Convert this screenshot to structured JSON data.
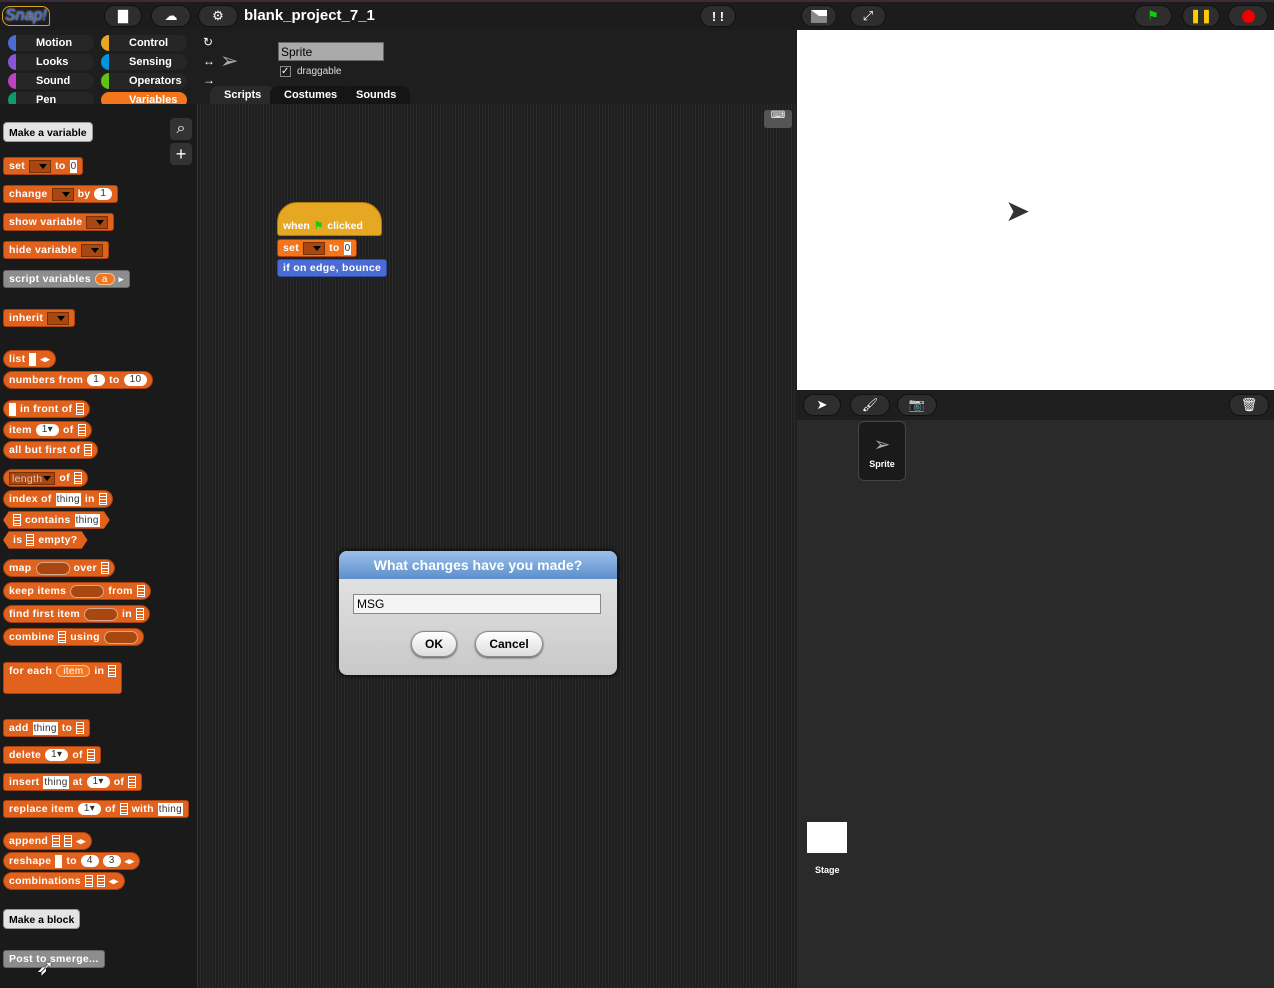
{
  "topbar": {
    "logo": "Snap!",
    "project_title": "blank_project_7_1",
    "icons": [
      "file-icon",
      "cloud-icon",
      "gear-icon",
      "footprints-icon",
      "stage-size-icon",
      "fullscreen-icon",
      "green-flag-icon",
      "pause-icon",
      "stop-icon"
    ]
  },
  "categories": [
    {
      "label": "Motion",
      "color": "#4a6cd4"
    },
    {
      "label": "Looks",
      "color": "#8a55d7"
    },
    {
      "label": "Sound",
      "color": "#bb42c3"
    },
    {
      "label": "Pen",
      "color": "#0e9a6c"
    },
    {
      "label": "Control",
      "color": "#e6a822"
    },
    {
      "label": "Sensing",
      "color": "#0494dc"
    },
    {
      "label": "Operators",
      "color": "#62c213"
    },
    {
      "label": "Variables",
      "color": "#f3761d",
      "selected": true
    }
  ],
  "palette": {
    "make_variable": "Make a variable",
    "make_block": "Make a block",
    "post": "Post to smerge...",
    "blocks": [
      [
        [
          "t",
          "set"
        ],
        [
          "d"
        ],
        [
          "t",
          "to"
        ],
        [
          "s",
          "0"
        ]
      ],
      [
        [
          "t",
          "change"
        ],
        [
          "d"
        ],
        [
          "t",
          "by"
        ],
        [
          "n",
          "1"
        ]
      ],
      [
        [
          "t",
          "show variable"
        ],
        [
          "d"
        ]
      ],
      [
        [
          "t",
          "hide variable"
        ],
        [
          "d"
        ]
      ],
      [
        [
          "t",
          "script variables"
        ],
        [
          "n",
          "a"
        ],
        [
          "a",
          "▸"
        ]
      ],
      [
        [
          "t",
          "inherit"
        ],
        [
          "d"
        ]
      ],
      [
        [
          "t",
          "list"
        ],
        [
          "s",
          " "
        ],
        [
          "a",
          "◂▸"
        ]
      ],
      [
        [
          "t",
          "numbers from"
        ],
        [
          "n",
          "1"
        ],
        [
          "t",
          "to"
        ],
        [
          "n",
          "10"
        ]
      ],
      [
        [
          "s",
          " "
        ],
        [
          "t",
          "in front of"
        ],
        [
          "l"
        ]
      ],
      [
        [
          "t",
          "item"
        ],
        [
          "n",
          "1▾"
        ],
        [
          "t",
          "of"
        ],
        [
          "l"
        ]
      ],
      [
        [
          "t",
          "all but first of"
        ],
        [
          "l"
        ]
      ],
      [
        [
          "d",
          "length"
        ],
        [
          "t",
          "of"
        ],
        [
          "l"
        ]
      ],
      [
        [
          "t",
          "index of"
        ],
        [
          "s",
          "thing"
        ],
        [
          "t",
          "in"
        ],
        [
          "l"
        ]
      ],
      [
        [
          "l"
        ],
        [
          "t",
          "contains"
        ],
        [
          "s",
          "thing"
        ]
      ],
      [
        [
          "t",
          "is"
        ],
        [
          "l"
        ],
        [
          "t",
          "empty?"
        ]
      ],
      [
        [
          "t",
          "map"
        ],
        [
          "r"
        ],
        [
          "t",
          "over"
        ],
        [
          "l"
        ]
      ],
      [
        [
          "t",
          "keep items"
        ],
        [
          "r"
        ],
        [
          "t",
          "from"
        ],
        [
          "l"
        ]
      ],
      [
        [
          "t",
          "find first item"
        ],
        [
          "r"
        ],
        [
          "t",
          "in"
        ],
        [
          "l"
        ]
      ],
      [
        [
          "t",
          "combine"
        ],
        [
          "l"
        ],
        [
          "t",
          "using"
        ],
        [
          "r"
        ]
      ],
      [
        [
          "t",
          "for each"
        ],
        [
          "n",
          "item"
        ],
        [
          "t",
          "in"
        ],
        [
          "l"
        ]
      ],
      [
        [
          "t",
          "add"
        ],
        [
          "s",
          "thing"
        ],
        [
          "t",
          "to"
        ],
        [
          "l"
        ]
      ],
      [
        [
          "t",
          "delete"
        ],
        [
          "n",
          "1▾"
        ],
        [
          "t",
          "of"
        ],
        [
          "l"
        ]
      ],
      [
        [
          "t",
          "insert"
        ],
        [
          "s",
          "thing"
        ],
        [
          "t",
          "at"
        ],
        [
          "n",
          "1▾"
        ],
        [
          "t",
          "of"
        ],
        [
          "l"
        ]
      ],
      [
        [
          "t",
          "replace item"
        ],
        [
          "n",
          "1▾"
        ],
        [
          "t",
          "of"
        ],
        [
          "l"
        ],
        [
          "t",
          "with"
        ],
        [
          "s",
          "thing"
        ]
      ],
      [
        [
          "t",
          "append"
        ],
        [
          "l"
        ],
        [
          "l"
        ],
        [
          "a",
          "◂▸"
        ]
      ],
      [
        [
          "t",
          "reshape"
        ],
        [
          "s",
          " "
        ],
        [
          "t",
          "to"
        ],
        [
          "n",
          "4"
        ],
        [
          "n",
          "3"
        ],
        [
          "a",
          "◂▸"
        ]
      ],
      [
        [
          "t",
          "combinations"
        ],
        [
          "l"
        ],
        [
          "l"
        ],
        [
          "a",
          "◂▸"
        ]
      ]
    ]
  },
  "sprite": {
    "name": "Sprite",
    "draggable_label": "draggable",
    "draggable": true,
    "tabs": [
      "Scripts",
      "Costumes",
      "Sounds"
    ]
  },
  "script": {
    "hat": [
      "when",
      "clicked"
    ],
    "set": [
      "set",
      "to",
      "0"
    ],
    "bounce": "if on edge, bounce"
  },
  "corral": {
    "sprite_label": "Sprite",
    "stage_label": "Stage"
  },
  "dialog": {
    "title": "What changes have you made?",
    "input_value": "MSG",
    "ok": "OK",
    "cancel": "Cancel"
  }
}
